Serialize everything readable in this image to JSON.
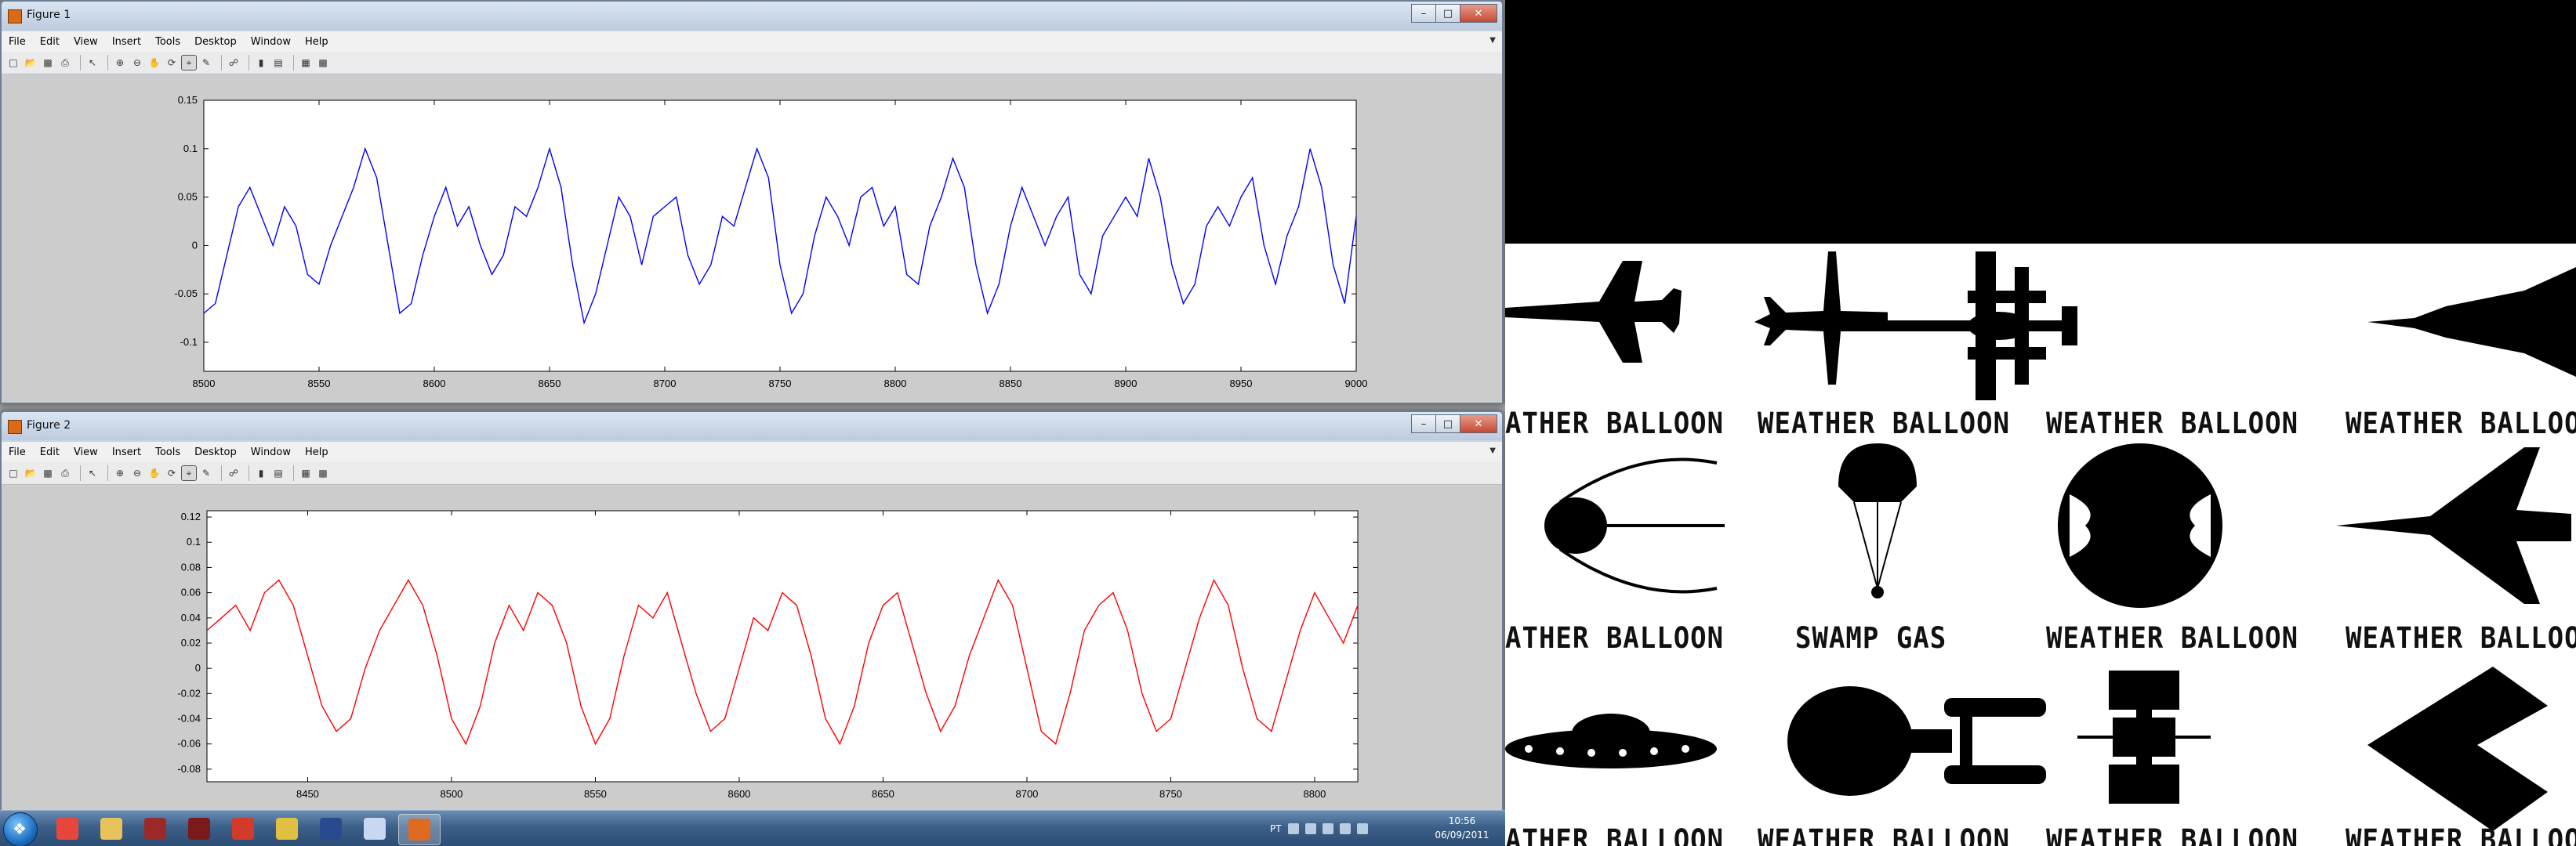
{
  "fig1": {
    "title": "Figure 1",
    "menu": [
      "File",
      "Edit",
      "View",
      "Insert",
      "Tools",
      "Desktop",
      "Window",
      "Help"
    ],
    "toolbar_icons": [
      "new-icon",
      "open-icon",
      "save-icon",
      "print-icon",
      "pointer-icon",
      "zoom-in-icon",
      "zoom-out-icon",
      "pan-icon",
      "rotate-icon",
      "data-cursor-icon",
      "brush-icon",
      "link-icon",
      "colorbar-icon",
      "legend-icon",
      "hide-plot-tools-icon",
      "show-plot-tools-icon"
    ],
    "chart_data": {
      "type": "line",
      "line_color": "#0000ff",
      "xlim": [
        8500,
        9000
      ],
      "ylim": [
        -0.13,
        0.15
      ],
      "xticks": [
        "8500",
        "8550",
        "8600",
        "8650",
        "8700",
        "8750",
        "8800",
        "8850",
        "8900",
        "8950",
        "9000"
      ],
      "yticks": [
        "0.15",
        "0.1",
        "0.05",
        "0",
        "-0.05",
        "-0.1"
      ],
      "x": [
        8500,
        8505,
        8510,
        8515,
        8520,
        8525,
        8530,
        8535,
        8540,
        8545,
        8550,
        8555,
        8560,
        8565,
        8570,
        8575,
        8580,
        8585,
        8590,
        8595,
        8600,
        8605,
        8610,
        8615,
        8620,
        8625,
        8630,
        8635,
        8640,
        8645,
        8650,
        8655,
        8660,
        8665,
        8670,
        8675,
        8680,
        8685,
        8690,
        8695,
        8700,
        8705,
        8710,
        8715,
        8720,
        8725,
        8730,
        8735,
        8740,
        8745,
        8750,
        8755,
        8760,
        8765,
        8770,
        8775,
        8780,
        8785,
        8790,
        8795,
        8800,
        8805,
        8810,
        8815,
        8820,
        8825,
        8830,
        8835,
        8840,
        8845,
        8850,
        8855,
        8860,
        8865,
        8870,
        8875,
        8880,
        8885,
        8890,
        8895,
        8900,
        8905,
        8910,
        8915,
        8920,
        8925,
        8930,
        8935,
        8940,
        8945,
        8950,
        8955,
        8960,
        8965,
        8970,
        8975,
        8980,
        8985,
        8990,
        8995,
        9000
      ],
      "y": [
        -0.07,
        -0.06,
        -0.01,
        0.04,
        0.06,
        0.03,
        0.0,
        0.04,
        0.02,
        -0.03,
        -0.04,
        0.0,
        0.03,
        0.06,
        0.1,
        0.07,
        0.0,
        -0.07,
        -0.06,
        -0.01,
        0.03,
        0.06,
        0.02,
        0.04,
        0.0,
        -0.03,
        -0.01,
        0.04,
        0.03,
        0.06,
        0.1,
        0.06,
        -0.02,
        -0.08,
        -0.05,
        0.0,
        0.05,
        0.03,
        -0.02,
        0.03,
        0.04,
        0.05,
        -0.01,
        -0.04,
        -0.02,
        0.03,
        0.02,
        0.06,
        0.1,
        0.07,
        -0.02,
        -0.07,
        -0.05,
        0.01,
        0.05,
        0.03,
        0.0,
        0.05,
        0.06,
        0.02,
        0.04,
        -0.03,
        -0.04,
        0.02,
        0.05,
        0.09,
        0.06,
        -0.02,
        -0.07,
        -0.04,
        0.02,
        0.06,
        0.03,
        0.0,
        0.03,
        0.05,
        -0.03,
        -0.05,
        0.01,
        0.03,
        0.05,
        0.03,
        0.09,
        0.05,
        -0.02,
        -0.06,
        -0.04,
        0.02,
        0.04,
        0.02,
        0.05,
        0.07,
        0.0,
        -0.04,
        0.01,
        0.04,
        0.1,
        0.06,
        -0.02,
        -0.06,
        0.03
      ]
    }
  },
  "fig2": {
    "title": "Figure 2",
    "menu": [
      "File",
      "Edit",
      "View",
      "Insert",
      "Tools",
      "Desktop",
      "Window",
      "Help"
    ],
    "chart_data": {
      "type": "line",
      "line_color": "#ff0000",
      "xlim": [
        8415,
        8815
      ],
      "ylim": [
        -0.09,
        0.125
      ],
      "xticks": [
        "8450",
        "8500",
        "8550",
        "8600",
        "8650",
        "8700",
        "8750",
        "8800"
      ],
      "xtick_values": [
        8450,
        8500,
        8550,
        8600,
        8650,
        8700,
        8750,
        8800
      ],
      "yticks": [
        "0.12",
        "0.1",
        "0.08",
        "0.06",
        "0.04",
        "0.02",
        "0",
        "-0.02",
        "-0.04",
        "-0.06",
        "-0.08"
      ],
      "x": [
        8415,
        8420,
        8425,
        8430,
        8435,
        8440,
        8445,
        8450,
        8455,
        8460,
        8465,
        8470,
        8475,
        8480,
        8485,
        8490,
        8495,
        8500,
        8505,
        8510,
        8515,
        8520,
        8525,
        8530,
        8535,
        8540,
        8545,
        8550,
        8555,
        8560,
        8565,
        8570,
        8575,
        8580,
        8585,
        8590,
        8595,
        8600,
        8605,
        8610,
        8615,
        8620,
        8625,
        8630,
        8635,
        8640,
        8645,
        8650,
        8655,
        8660,
        8665,
        8670,
        8675,
        8680,
        8685,
        8690,
        8695,
        8700,
        8705,
        8710,
        8715,
        8720,
        8725,
        8730,
        8735,
        8740,
        8745,
        8750,
        8755,
        8760,
        8765,
        8770,
        8775,
        8780,
        8785,
        8790,
        8795,
        8800,
        8805,
        8810,
        8815
      ],
      "y": [
        0.03,
        0.04,
        0.05,
        0.03,
        0.06,
        0.07,
        0.05,
        0.01,
        -0.03,
        -0.05,
        -0.04,
        0.0,
        0.03,
        0.05,
        0.07,
        0.05,
        0.01,
        -0.04,
        -0.06,
        -0.03,
        0.02,
        0.05,
        0.03,
        0.06,
        0.05,
        0.02,
        -0.03,
        -0.06,
        -0.04,
        0.01,
        0.05,
        0.04,
        0.06,
        0.02,
        -0.02,
        -0.05,
        -0.04,
        0.0,
        0.04,
        0.03,
        0.06,
        0.05,
        0.01,
        -0.04,
        -0.06,
        -0.03,
        0.02,
        0.05,
        0.06,
        0.02,
        -0.02,
        -0.05,
        -0.03,
        0.01,
        0.04,
        0.07,
        0.05,
        0.0,
        -0.05,
        -0.06,
        -0.02,
        0.03,
        0.05,
        0.06,
        0.03,
        -0.02,
        -0.05,
        -0.04,
        0.0,
        0.04,
        0.07,
        0.05,
        0.0,
        -0.04,
        -0.05,
        -0.01,
        0.03,
        0.06,
        0.04,
        0.02,
        0.05
      ]
    }
  },
  "taskbar": {
    "apps": [
      {
        "name": "chrome-icon",
        "color": "#e8453c"
      },
      {
        "name": "explorer-icon",
        "color": "#e8c25a"
      },
      {
        "name": "altium-icon",
        "color": "#9a2a2a"
      },
      {
        "name": "pickit-icon",
        "color": "#7a1a1a"
      },
      {
        "name": "flash-icon",
        "color": "#d23a2a"
      },
      {
        "name": "terminal-icon",
        "color": "#e0c040"
      },
      {
        "name": "pic-icon",
        "color": "#2a4a90"
      },
      {
        "name": "paint-icon",
        "color": "#c8d8f0"
      },
      {
        "name": "matlab-icon",
        "color": "#e06a20"
      }
    ],
    "lang": "PT",
    "time": "10:56",
    "date": "06/09/2011"
  },
  "poster": {
    "captions": [
      "ATHER BALLOON",
      "WEATHER BALLOON",
      "WEATHER BALLOON",
      "WEATHER BALLOON",
      "ATHER BALLOON",
      "SWAMP GAS",
      "WEATHER BALLOON",
      "WEATHER BALLOON",
      "ATHER BALLOON",
      "WEATHER BALLOON",
      "WEATHER BALLOON",
      "WEATHER BALLOON"
    ]
  }
}
